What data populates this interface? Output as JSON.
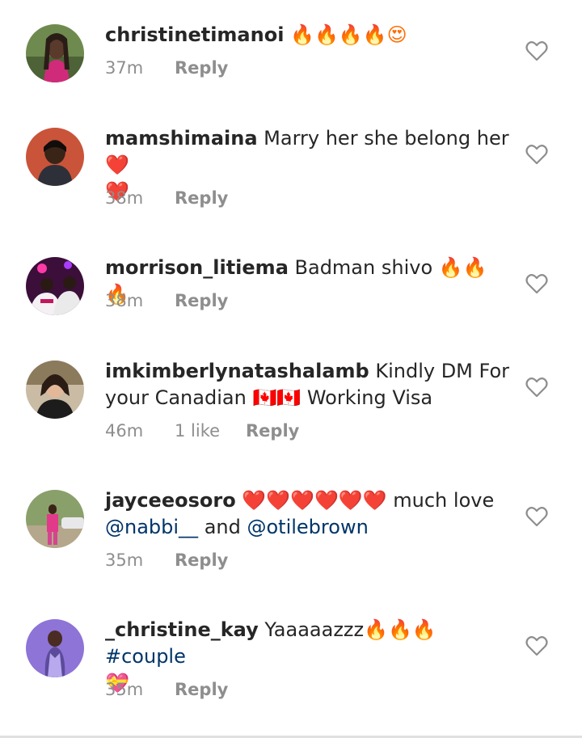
{
  "comments": [
    {
      "username": "christinetimanoi",
      "parts": [
        {
          "t": "emoji",
          "v": "🔥🔥🔥🔥😍"
        }
      ],
      "time": "37m",
      "likes": "",
      "reply_label": "Reply"
    },
    {
      "username": "mamshimaina",
      "parts": [
        {
          "t": "text",
          "v": " Marry her she belong her"
        },
        {
          "t": "emoji",
          "v": "❤️"
        },
        {
          "t": "br",
          "v": ""
        },
        {
          "t": "emoji",
          "v": "❤️"
        }
      ],
      "time": "38m",
      "likes": "",
      "reply_label": "Reply"
    },
    {
      "username": "morrison_litiema",
      "parts": [
        {
          "t": "text",
          "v": " Badman shivo "
        },
        {
          "t": "emoji",
          "v": "🔥🔥🔥"
        }
      ],
      "time": "38m",
      "likes": "",
      "reply_label": "Reply"
    },
    {
      "username": "imkimberlynatashalamb",
      "parts": [
        {
          "t": "text",
          "v": " Kindly DM For your Canadian "
        },
        {
          "t": "emoji",
          "v": "🇨🇦🇨🇦"
        },
        {
          "t": "text",
          "v": " Working Visa"
        }
      ],
      "time": "46m",
      "likes": "1 like",
      "reply_label": "Reply"
    },
    {
      "username": "jayceeosoro",
      "parts": [
        {
          "t": "emoji",
          "v": " ❤️❤️❤️❤️❤️❤️"
        },
        {
          "t": "text",
          "v": " much love "
        },
        {
          "t": "mention",
          "v": "@nabbi__"
        },
        {
          "t": "text",
          "v": " and "
        },
        {
          "t": "mention",
          "v": "@otilebrown"
        }
      ],
      "time": "35m",
      "likes": "",
      "reply_label": "Reply"
    },
    {
      "username": "_christine_kay",
      "parts": [
        {
          "t": "text",
          "v": " Yaaaaazzz"
        },
        {
          "t": "emoji",
          "v": "🔥🔥🔥"
        },
        {
          "t": "text",
          "v": " "
        },
        {
          "t": "mention",
          "v": "#couple"
        },
        {
          "t": "br",
          "v": ""
        },
        {
          "t": "emoji",
          "v": "💝"
        }
      ],
      "time": "35m",
      "likes": "",
      "reply_label": "Reply"
    }
  ],
  "icons": {
    "like": "heart-outline-icon"
  }
}
